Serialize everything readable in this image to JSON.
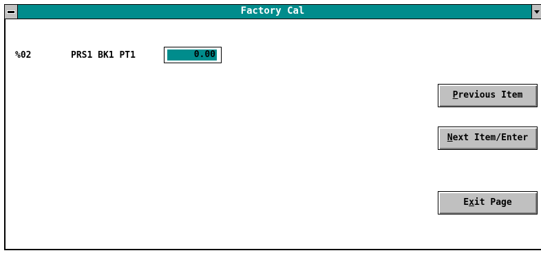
{
  "window": {
    "title": "Factory Cal"
  },
  "row": {
    "code": "%02",
    "name": "PRS1 BK1 PT1",
    "value": "0.00"
  },
  "buttons": {
    "previous": {
      "mnemonic": "P",
      "rest": "revious Item"
    },
    "next": {
      "mnemonic": "N",
      "rest": "ext Item/Enter"
    },
    "exit": {
      "pre": "E",
      "mnemonic": "x",
      "rest": "it Page"
    }
  },
  "colors": {
    "titlebar": "#008c8c",
    "field_highlight": "#008c8c",
    "button_face": "#c0c0c0"
  },
  "icons": {
    "system_menu": "system-menu-icon",
    "dropdown": "chevron-down-icon"
  }
}
